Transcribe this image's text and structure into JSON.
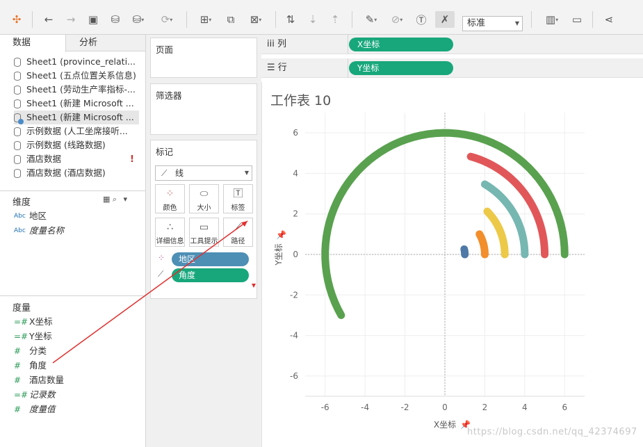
{
  "toolbar": {
    "select_value": "标准",
    "icons": [
      "tableau-logo-icon",
      "undo-icon",
      "redo-icon",
      "save-icon",
      "new-datasource-icon",
      "datasource-icon",
      "refresh-icon",
      "new-worksheet-icon",
      "duplicate-sheet-icon",
      "clear-sheet-icon",
      "swap-icon",
      "sort-asc-icon",
      "sort-desc-icon",
      "highlight-icon",
      "group-icon",
      "label-icon",
      "fix-axes-icon",
      "show-me-icon",
      "presentation-icon",
      "share-icon"
    ]
  },
  "left": {
    "tabs": {
      "data": "数据",
      "analysis": "分析"
    },
    "datasources": [
      "Sheet1 (province_relati...",
      "Sheet1 (五点位置关系信息)",
      "Sheet1 (劳动生产率指标-...",
      "Sheet1 (新建 Microsoft ...",
      "Sheet1 (新建 Microsoft ...",
      "示例数据 (人工坐席接听...",
      "示例数据 (线路数据)",
      "酒店数据",
      "酒店数据 (酒店数据)"
    ],
    "warning": "!",
    "dimensions_title": "维度",
    "dimensions": [
      {
        "type": "Abc",
        "label": "地区",
        "italic": false
      },
      {
        "type": "Abc",
        "label": "度量名称",
        "italic": true
      }
    ],
    "measures_title": "度量",
    "measures": [
      {
        "type": "=#",
        "label": "X坐标",
        "italic": false
      },
      {
        "type": "=#",
        "label": "Y坐标",
        "italic": false
      },
      {
        "type": "#",
        "label": "分类",
        "italic": false
      },
      {
        "type": "#",
        "label": "角度",
        "italic": false
      },
      {
        "type": "#",
        "label": "酒店数量",
        "italic": false
      },
      {
        "type": "=#",
        "label": "记录数",
        "italic": true
      },
      {
        "type": "#",
        "label": "度量值",
        "italic": true
      }
    ]
  },
  "cards": {
    "pages": "页面",
    "filters": "筛选器",
    "marks": "标记",
    "mark_type": "线",
    "buttons": [
      "颜色",
      "大小",
      "标签",
      "详细信息",
      "工具提示",
      "路径"
    ],
    "pill_color": "地区",
    "pill_path": "角度"
  },
  "shelves": {
    "columns_label": "列",
    "rows_label": "行",
    "columns_pill": "X坐标",
    "rows_pill": "Y坐标"
  },
  "view": {
    "title": "工作表 10",
    "xlabel": "X坐标",
    "ylabel": "Y坐标"
  },
  "chart_data": {
    "type": "line",
    "title": "工作表 10",
    "xlabel": "X坐标",
    "ylabel": "Y坐标",
    "xlim": [
      -7,
      7
    ],
    "ylim": [
      -7,
      7
    ],
    "xticks": [
      -6,
      -4,
      -2,
      0,
      2,
      4,
      6
    ],
    "yticks": [
      -6,
      -4,
      -2,
      0,
      2,
      4,
      6
    ],
    "grid": true,
    "series": [
      {
        "radius": 1,
        "start_deg": 0,
        "end_deg": 15,
        "color": "#4e79a7"
      },
      {
        "radius": 2,
        "start_deg": 0,
        "end_deg": 30,
        "color": "#f28e2b"
      },
      {
        "radius": 3,
        "start_deg": 0,
        "end_deg": 45,
        "color": "#edc948"
      },
      {
        "radius": 4,
        "start_deg": 0,
        "end_deg": 60,
        "color": "#76b7b2"
      },
      {
        "radius": 5,
        "start_deg": 0,
        "end_deg": 75,
        "color": "#e15759"
      },
      {
        "radius": 6,
        "start_deg": 0,
        "end_deg": 210,
        "color": "#59a14f"
      }
    ]
  },
  "watermark": "https://blog.csdn.net/qq_42374697"
}
